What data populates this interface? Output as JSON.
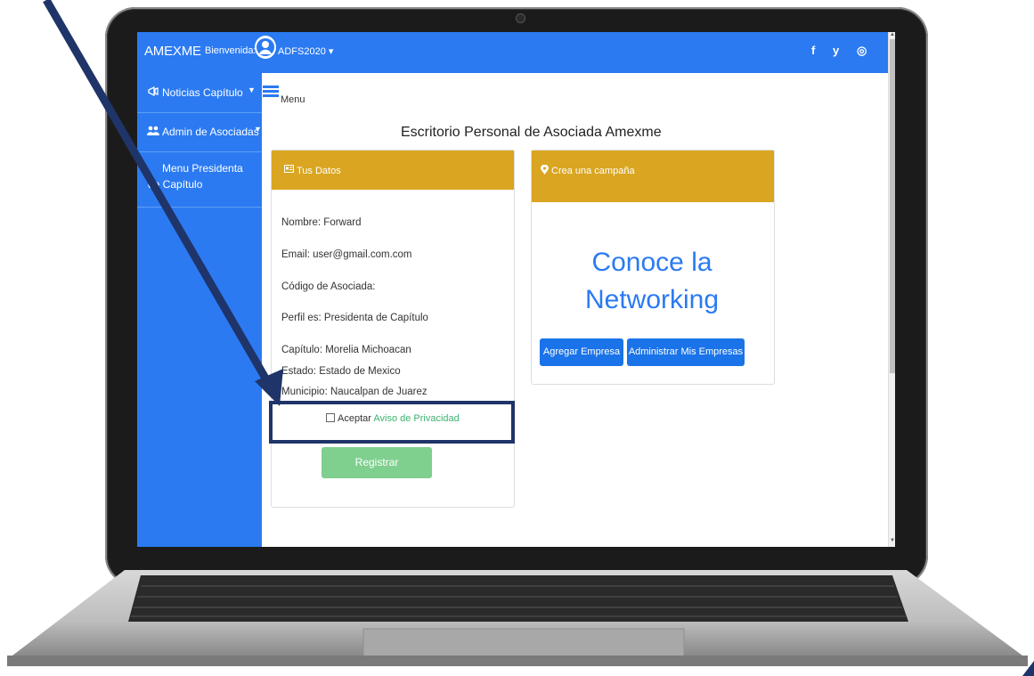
{
  "app": {
    "brand": "AMEXME",
    "welcome_label": "Bienvenida:",
    "username": "ADFS2020",
    "social": [
      "f",
      "y",
      "◎"
    ]
  },
  "sidebar": {
    "items": [
      {
        "label": "Noticias Capítulo",
        "icon": "megaphone-icon"
      },
      {
        "label": "Admin de Asociadas",
        "icon": "users-icon"
      },
      {
        "label_line1": "Menu Presidenta",
        "label_line2": "de Capítulo"
      }
    ]
  },
  "main": {
    "menu_label": "Menu",
    "title": "Escritorio Personal de Asociada Amexme"
  },
  "card_data": {
    "header": "Tus Datos",
    "nombre": "Nombre: Forward",
    "email": "Email: user@gmail.com.com",
    "codigo": "Código de Asociada:",
    "perfil": "Perfil es: Presidenta de Capítulo",
    "capitulo": "Capítulo:   Morelia Michoacan",
    "estado": "Estado:     Estado de Mexico",
    "municipio": "Municipio: Naucalpan de Juarez",
    "accept_label": "Aceptar",
    "privacy_link": "Aviso de Privacidad",
    "register_button": "Registrar"
  },
  "card_campaign": {
    "header": "Crea una campaña",
    "headline_line1": "Conoce la",
    "headline_line2": "Networking",
    "add_button": "Agregar Empresa",
    "manage_button": "Administrar Mis Empresas"
  },
  "colors": {
    "primary": "#2b7af2",
    "card_header": "#daa520",
    "register": "#7fcf8f",
    "annotation": "#1f3468"
  }
}
